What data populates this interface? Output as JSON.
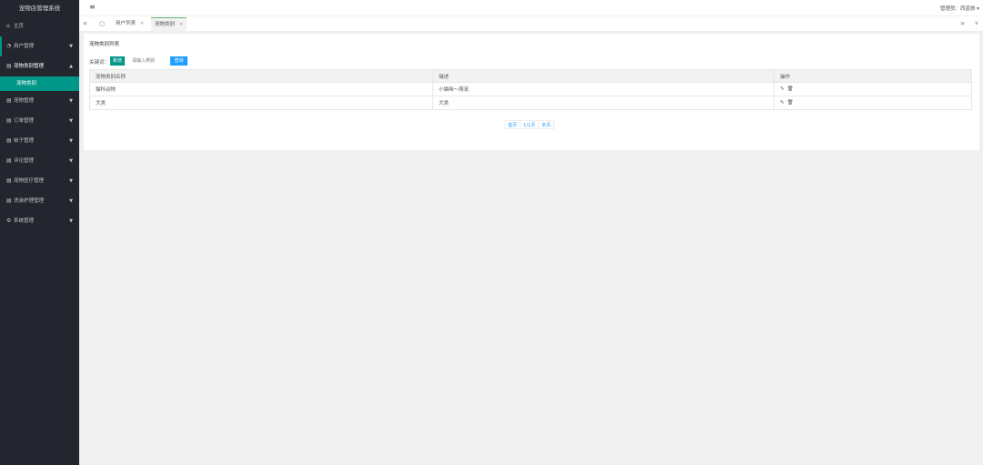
{
  "sidebar": {
    "title": "宠物店管理系统",
    "items": [
      {
        "label": "主页",
        "icon": "home-icon"
      },
      {
        "label": "用户管理",
        "icon": "user-icon"
      },
      {
        "label": "宠物类别管理",
        "icon": "category-icon",
        "sub": [
          "宠物类别"
        ]
      },
      {
        "label": "宠物管理",
        "icon": "grid-icon"
      },
      {
        "label": "订单管理",
        "icon": "grid-icon"
      },
      {
        "label": "帖子管理",
        "icon": "grid-icon"
      },
      {
        "label": "评论管理",
        "icon": "grid-icon"
      },
      {
        "label": "宠物医疗管理",
        "icon": "grid-icon"
      },
      {
        "label": "洗澡护理管理",
        "icon": "grid-icon"
      },
      {
        "label": "系统管理",
        "icon": "gear-icon"
      }
    ]
  },
  "topbar": {
    "menu_icon": "≡",
    "admin": "管理员：西蓝旅 ▾"
  },
  "tabs": [
    {
      "label": "用户列表"
    },
    {
      "label": "宠物类别"
    }
  ],
  "panel": {
    "title": "宠物类别列表",
    "keyword_label": "关键词：",
    "add_label": "新增",
    "search_placeholder": "请输入类别",
    "query_label": "查询"
  },
  "table": {
    "headers": [
      "宠物类别名称",
      "描述",
      "操作"
    ],
    "rows": [
      [
        "猫科动物",
        "小猫咪～萌宠"
      ],
      [
        "犬类",
        "犬类"
      ]
    ]
  },
  "pager": {
    "first": "首页",
    "info": "1/1页",
    "last": "末页"
  },
  "colors": {
    "sidebar_bg": "#23262e",
    "accent": "#009688",
    "primary_blue": "#1e9fff"
  }
}
